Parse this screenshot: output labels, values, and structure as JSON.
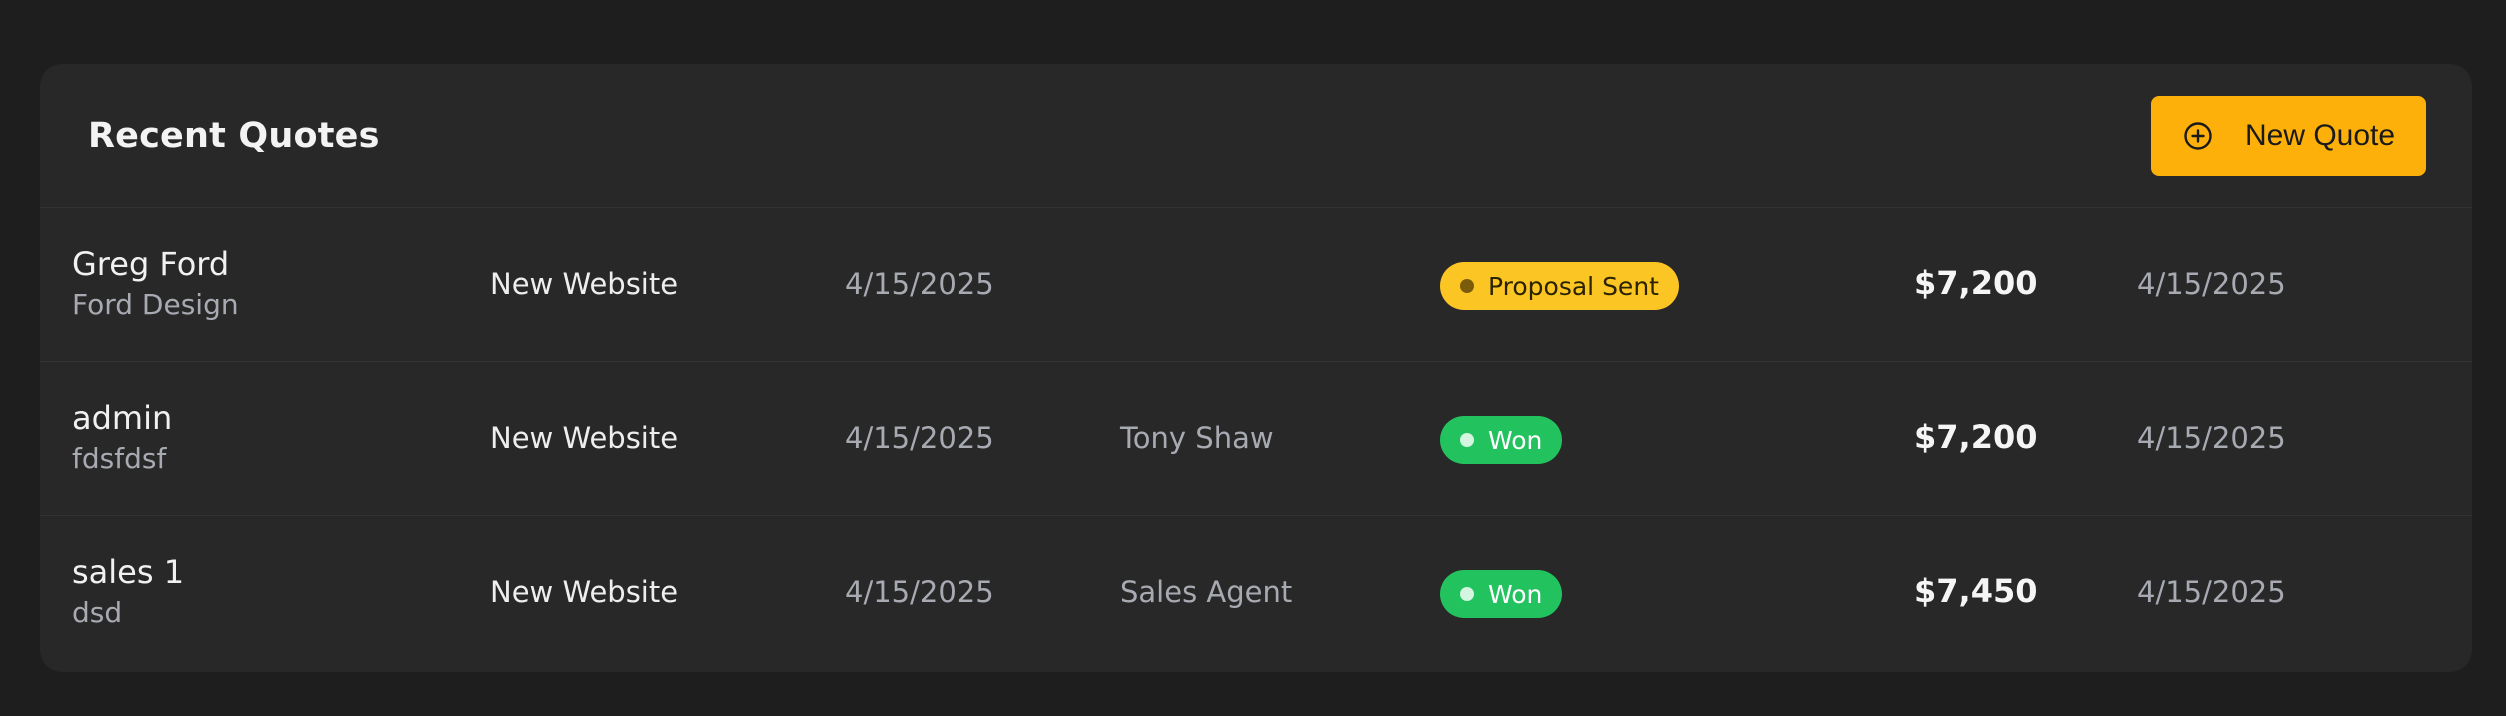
{
  "card": {
    "title": "Recent Quotes",
    "new_button_label": "New Quote"
  },
  "quotes": [
    {
      "name": "Greg Ford",
      "company": "Ford Design",
      "project": "New Website",
      "date": "4/15/2025",
      "agent": "",
      "status": "Proposal Sent",
      "amount": "$7,200",
      "updated": "4/15/2025"
    },
    {
      "name": "admin",
      "company": "fdsfdsf",
      "project": "New Website",
      "date": "4/15/2025",
      "agent": "Tony Shaw",
      "status": "Won",
      "amount": "$7,200",
      "updated": "4/15/2025"
    },
    {
      "name": "sales 1",
      "company": "dsd",
      "project": "New Website",
      "date": "4/15/2025",
      "agent": "Sales Agent",
      "status": "Won",
      "amount": "$7,450",
      "updated": "4/15/2025"
    }
  ],
  "colors": {
    "accent": "#fdb00a",
    "status_proposal_sent": "#fbc623",
    "status_won": "#22c35e"
  },
  "icons": {
    "new_button": "plus-circle-icon"
  }
}
